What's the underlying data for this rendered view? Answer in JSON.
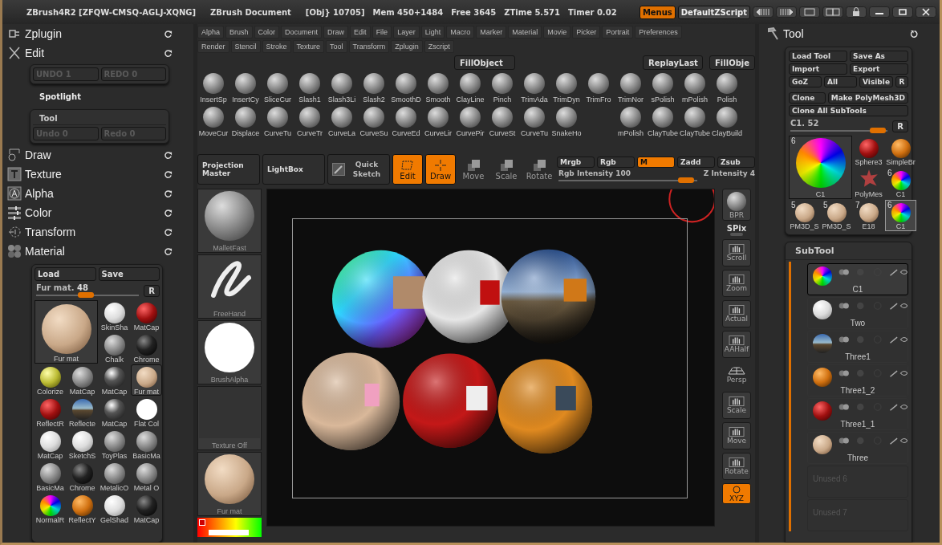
{
  "title_bar": {
    "app_title": "ZBrush4R2 [ZFQW-CMSQ-AGLJ-XQNG]",
    "document": "ZBrush Document",
    "stats": [
      "[Obj} 10705]",
      "Mem 450+1484",
      "Free 3645",
      "ZTime 5.571",
      "Timer 0.02"
    ],
    "buttons": [
      {
        "label": "Menus",
        "selected": true
      },
      {
        "label": "DefaultZScript",
        "selected": false
      }
    ]
  },
  "menu_rows": [
    [
      "Alpha",
      "Brush",
      "Color",
      "Document",
      "Draw",
      "Edit",
      "File",
      "Layer",
      "Light",
      "Macro",
      "Marker",
      "Material",
      "Movie",
      "Picker",
      "Portrait",
      "Preferences"
    ],
    [
      "Render",
      "Stencil",
      "Stroke",
      "Texture",
      "Tool",
      "Transform",
      "Zplugin",
      "Zscript"
    ]
  ],
  "left_panel": {
    "zplugin": "Zplugin",
    "edit": {
      "title": "Edit",
      "buttons": [
        {
          "label": "UNDO 1",
          "disabled": true
        },
        {
          "label": "REDO 0",
          "disabled": true
        }
      ]
    },
    "spotlight": "Spotlight",
    "tool_history": {
      "title": "Tool",
      "buttons": [
        {
          "label": "Undo 0",
          "disabled": true
        },
        {
          "label": "Redo 0",
          "disabled": true
        }
      ]
    },
    "palettes": [
      "Draw",
      "Texture",
      "Alpha",
      "Color",
      "Transform",
      "Material"
    ],
    "material": {
      "load": "Load",
      "save": "Save",
      "slider": {
        "label": "Fur mat.",
        "value": "48",
        "level": 0.48
      },
      "reset": "R",
      "current": "Fur mat",
      "items": [
        {
          "label": "SkinSha",
          "selected": false
        },
        {
          "label": "MatCap",
          "selected": false
        },
        {
          "label": "Chalk",
          "selected": false
        },
        {
          "label": "Chrome",
          "selected": false
        },
        {
          "label": "Colorize",
          "selected": false
        },
        {
          "label": "MatCap",
          "selected": false
        },
        {
          "label": "MatCap",
          "selected": false
        },
        {
          "label": "Fur mat",
          "selected": true
        },
        {
          "label": "ReflectR",
          "selected": false
        },
        {
          "label": "Reflecte",
          "selected": false
        },
        {
          "label": "MatCap",
          "selected": false
        },
        {
          "label": "Flat Col",
          "selected": false
        },
        {
          "label": "MatCap",
          "selected": false
        },
        {
          "label": "SketchS",
          "selected": false
        },
        {
          "label": "ToyPlas",
          "selected": false
        },
        {
          "label": "BasicMa",
          "selected": false
        },
        {
          "label": "BasicMa",
          "selected": false
        },
        {
          "label": "Chrome",
          "selected": false
        },
        {
          "label": "MetalicO",
          "selected": false
        },
        {
          "label": "Metal O",
          "selected": false
        },
        {
          "label": "NormalR",
          "selected": false
        },
        {
          "label": "ReflectY",
          "selected": false
        },
        {
          "label": "GelShad",
          "selected": false
        },
        {
          "label": "MatCap",
          "selected": false
        }
      ]
    }
  },
  "quick_buttons": [
    "FillObject",
    "ReplayLast",
    "FillObje"
  ],
  "brush_rows": [
    [
      "InsertSp",
      "InsertCy",
      "SliceCur",
      "Slash1",
      "Slash3Li",
      "Slash2",
      "SmoothD",
      "Smooth",
      "ClayLine",
      "Pinch",
      "TrimAda",
      "TrimDyn",
      "TrimFro",
      "TrimNor",
      "sPolish",
      "mPolish",
      "Polish"
    ],
    [
      "MoveCur",
      "Displace",
      "CurveTu",
      "CurveTr",
      "CurveLa",
      "CurveSu",
      "CurveEd",
      "CurveLir",
      "CurvePir",
      "CurveSt",
      "CurveTu",
      "SnakeHo",
      "",
      "mPolish",
      "ClayTube",
      "ClayTube",
      "ClayBuild"
    ]
  ],
  "toolbar": {
    "modes": [
      "Projection Master",
      "LightBox",
      "Quick Sketch"
    ],
    "transform": [
      {
        "label": "Edit",
        "on": true
      },
      {
        "label": "Draw",
        "on": true
      },
      {
        "label": "Move",
        "on": false
      },
      {
        "label": "Scale",
        "on": false
      },
      {
        "label": "Rotate",
        "on": false
      }
    ],
    "color_modes": [
      {
        "label": "Mrgb",
        "selected": false
      },
      {
        "label": "Rgb",
        "selected": false
      },
      {
        "label": "M",
        "selected": true
      },
      {
        "label": "Zadd",
        "selected": false
      },
      {
        "label": "Zsub",
        "selected": false
      }
    ],
    "rgb_intensity": {
      "label": "Rgb Intensity",
      "value": "100",
      "level": 0.92
    },
    "z_intensity": "Z Intensity 4"
  },
  "tray": [
    "MalletFast",
    "FreeHand",
    "BrushAlpha",
    "Texture Off",
    "Fur mat"
  ],
  "shelf": [
    {
      "label": "BPR",
      "active": false
    },
    {
      "label": "SPix",
      "active": false
    },
    {
      "label": "Scroll",
      "active": false
    },
    {
      "label": "Zoom",
      "active": false
    },
    {
      "label": "Actual",
      "active": false
    },
    {
      "label": "AAHalf",
      "active": false
    },
    {
      "label": "Persp",
      "active": false
    },
    {
      "label": "Scale",
      "active": false
    },
    {
      "label": "Move",
      "active": false
    },
    {
      "label": "Rotate",
      "active": false
    },
    {
      "label": "XYZ",
      "active": true
    }
  ],
  "tool_panel": {
    "title": "Tool",
    "buttons": [
      [
        "Load Tool",
        "Save As"
      ],
      [
        "Import",
        "Export"
      ],
      [
        "GoZ",
        "All",
        "Visible",
        "R"
      ],
      [
        "Clone",
        "Make PolyMesh3D"
      ],
      [
        "Clone All SubTools"
      ]
    ],
    "slider": {
      "label": "C1. 52",
      "level": 0.9
    },
    "reset": "R",
    "tools": [
      {
        "label": "C1",
        "count": "6",
        "selected": false
      },
      {
        "label": "Sphere3",
        "selected": false
      },
      {
        "label": "SimpleBr",
        "selected": false
      },
      {
        "label": "PolyMes",
        "selected": false
      },
      {
        "label": "C1",
        "count": "6",
        "selected": false
      },
      {
        "label": "PM3D_S",
        "count": "5",
        "selected": false
      },
      {
        "label": "PM3D_S",
        "count": "5",
        "selected": false
      },
      {
        "label": "E18",
        "count": "7",
        "selected": false
      },
      {
        "label": "C1",
        "count": "6",
        "selected": true
      }
    ]
  },
  "subtool": {
    "title": "SubTool",
    "items": [
      {
        "label": "C1",
        "selected": true
      },
      {
        "label": "Two",
        "selected": false
      },
      {
        "label": "Three1",
        "selected": false
      },
      {
        "label": "Three1_2",
        "selected": false
      },
      {
        "label": "Three1_1",
        "selected": false
      },
      {
        "label": "Three",
        "selected": false
      }
    ],
    "unused": [
      "Unused 6",
      "Unused 7"
    ]
  }
}
